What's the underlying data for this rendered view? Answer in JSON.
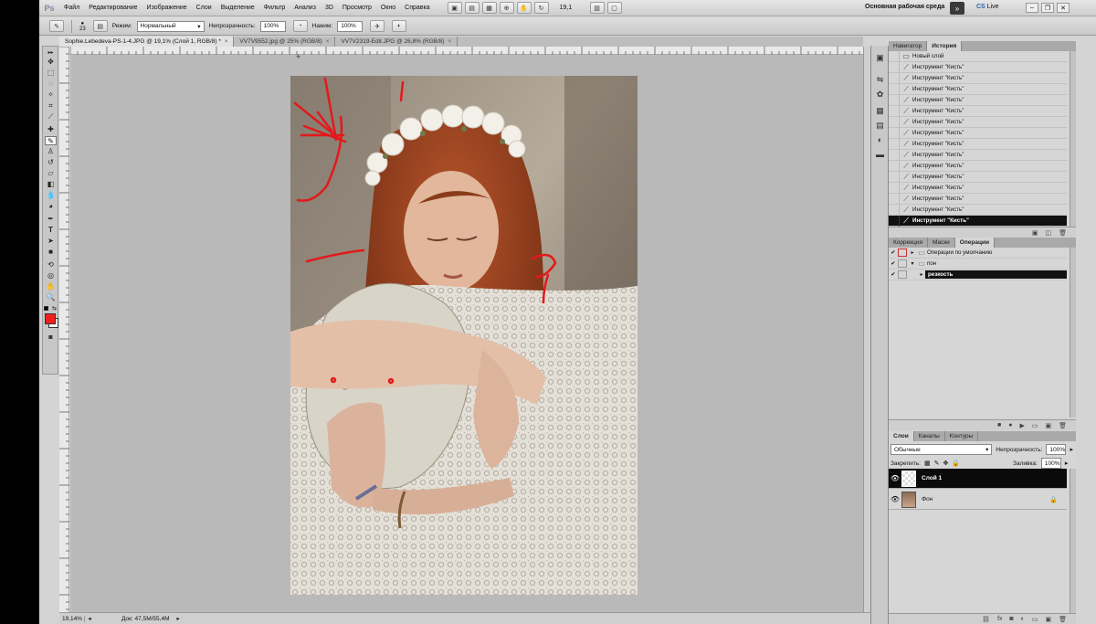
{
  "app": {
    "logo": "Ps"
  },
  "menu": [
    "Файл",
    "Редактирование",
    "Изображение",
    "Слои",
    "Выделение",
    "Фильтр",
    "Анализ",
    "3D",
    "Просмотр",
    "Окно",
    "Справка"
  ],
  "menubar": {
    "zoom": "19,1",
    "workspace": "Основная рабочая среда",
    "cslive_prefix": "CS",
    "cslive_label": "Live"
  },
  "options": {
    "brush_size": "23",
    "mode_label": "Режим:",
    "mode_value": "Нормальный",
    "opacity_label": "Непрозрачность:",
    "opacity_value": "100%",
    "pressure_label": "Нажим:",
    "pressure_value": "100%"
  },
  "tabs": [
    {
      "label": "Sophie.Lebedeva-PS-1-4.JPG @ 19,1% (Слой 1, RGB/8) *",
      "close": "×"
    },
    {
      "label": "VV7V9552.jpg @ 25% (RGB/8)",
      "close": "×"
    },
    {
      "label": "VV7V2319-Edit.JPG @ 26,8% (RGB/8)",
      "close": "×"
    }
  ],
  "status": {
    "zoom": "19,14%",
    "doc": "Док: 47,5M/55,4M"
  },
  "colors": {
    "foreground": "#f11e1e",
    "background": "#ffffff",
    "highlight": "#0d0d0d",
    "brush_stroke": "#e3191b"
  },
  "history_panel": {
    "tabs": [
      "Навигатор",
      "История"
    ],
    "first_item": "Новый слой",
    "items": [
      "Инструмент \"Кисть\"",
      "Инструмент \"Кисть\"",
      "Инструмент \"Кисть\"",
      "Инструмент \"Кисть\"",
      "Инструмент \"Кисть\"",
      "Инструмент \"Кисть\"",
      "Инструмент \"Кисть\"",
      "Инструмент \"Кисть\"",
      "Инструмент \"Кисть\"",
      "Инструмент \"Кисть\"",
      "Инструмент \"Кисть\"",
      "Инструмент \"Кисть\"",
      "Инструмент \"Кисть\"",
      "Инструмент \"Кисть\"",
      "Инструмент \"Кисть\""
    ]
  },
  "actions_panel": {
    "tabs": [
      "Коррекция",
      "Маски",
      "Операции"
    ],
    "items": [
      {
        "label": "Операции по умолчанию",
        "level": 0
      },
      {
        "label": "пон",
        "level": 0
      },
      {
        "label": "резкость",
        "level": 1
      }
    ]
  },
  "layers_panel": {
    "tabs": [
      "Слои",
      "Каналы",
      "Контуры"
    ],
    "blend_mode": "Обычные",
    "opacity_label": "Непрозрачность:",
    "opacity_value": "100%",
    "lock_label": "Закрепить:",
    "fill_label": "Заливка:",
    "fill_value": "100%",
    "layers": [
      {
        "name": "Слой 1",
        "active": true
      },
      {
        "name": "Фон",
        "active": false,
        "locked": true
      }
    ]
  }
}
